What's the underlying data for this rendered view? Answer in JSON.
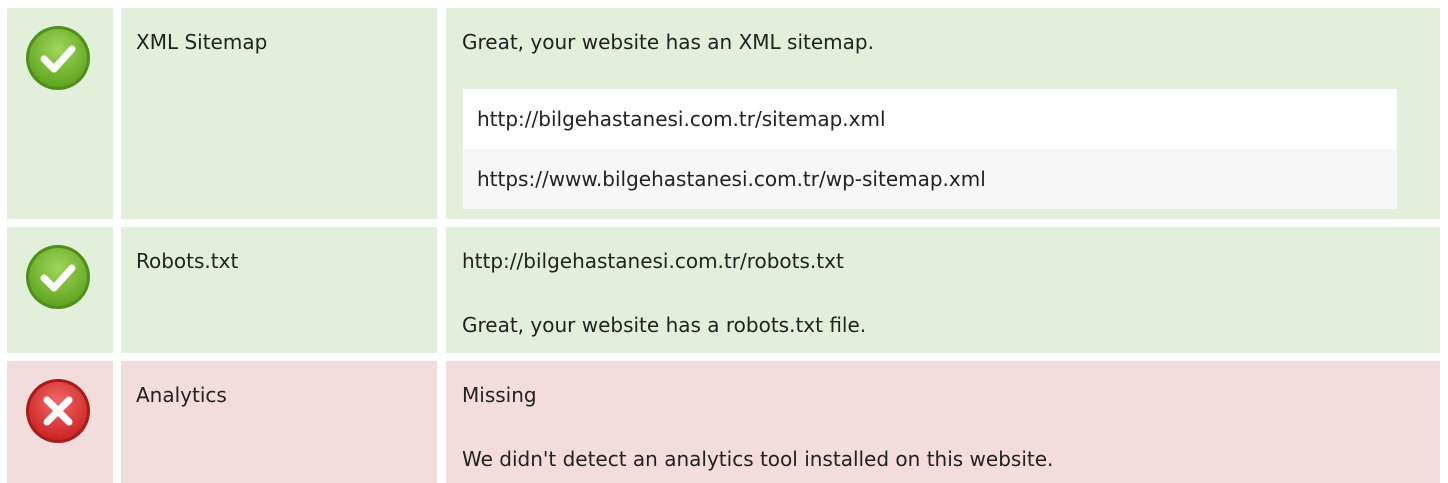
{
  "checks": {
    "sitemap": {
      "status": "success",
      "icon": "check-circle-icon",
      "label": "XML Sitemap",
      "message": "Great, your website has an XML sitemap.",
      "urls": [
        "http://bilgehastanesi.com.tr/sitemap.xml",
        "https://www.bilgehastanesi.com.tr/wp-sitemap.xml"
      ]
    },
    "robots": {
      "status": "success",
      "icon": "check-circle-icon",
      "label": "Robots.txt",
      "url": "http://bilgehastanesi.com.tr/robots.txt",
      "message": "Great, your website has a robots.txt file."
    },
    "analytics": {
      "status": "error",
      "icon": "error-circle-icon",
      "label": "Analytics",
      "value": "Missing",
      "message": "We didn't detect an analytics tool installed on this website."
    }
  },
  "colors": {
    "success_row": "#e2efda",
    "error_row": "#f2dcdc",
    "success_icon": "#74b72e",
    "error_icon": "#e23a3a"
  }
}
